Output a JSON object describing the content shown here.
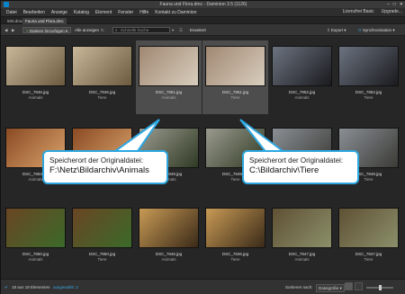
{
  "window": {
    "title": "Fauna und Flora.dmc - Daminion 3.5 (1126)",
    "controls": [
      "–",
      "□",
      "✕"
    ]
  },
  "menubar": {
    "items": [
      "Datei",
      "Bearbeiten",
      "Anzeige",
      "Katalog",
      "Element",
      "Fenster",
      "Hilfe",
      "Kontakt zu Daminion"
    ],
    "right": [
      "Lizenzfrei Basic",
      "Upgrade..."
    ]
  },
  "tabs": [
    {
      "label": "500.dmc"
    },
    {
      "label": "Fauna und Flora.dmc"
    }
  ],
  "toolbar": {
    "add_files_label": "Dateien hinzufügen",
    "show_all_label": "Alle anzeigen",
    "search_placeholder": "Schnelle Suche",
    "advanced_label": "Erweitert",
    "export_label": "Export",
    "sync_label": "Synchronisation"
  },
  "grid": {
    "rows": [
      [
        {
          "file": "DSC_7846.jpg",
          "tag": "Animals",
          "selected": false,
          "c1": "#c9b79a",
          "c2": "#6b5a3e"
        },
        {
          "file": "DSC_7846.jpg",
          "tag": "Tiere",
          "selected": false,
          "c1": "#c9b79a",
          "c2": "#6b5a3e"
        },
        {
          "file": "DSC_7851.jpg",
          "tag": "Animals",
          "selected": true,
          "c1": "#a08872",
          "c2": "#d8cdbd"
        },
        {
          "file": "DSC_7851.jpg",
          "tag": "Tiere",
          "selected": true,
          "c1": "#a08872",
          "c2": "#d8cdbd"
        },
        {
          "file": "DSC_7852.jpg",
          "tag": "Animals",
          "selected": false,
          "c1": "#6c7380",
          "c2": "#1a1a1e"
        },
        {
          "file": "DSC_7852.jpg",
          "tag": "Tiere",
          "selected": false,
          "c1": "#6c7380",
          "c2": "#1a1a1e"
        }
      ],
      [
        {
          "file": "DSC_7853.jpg",
          "tag": "Animals",
          "selected": false,
          "c1": "#8a4a24",
          "c2": "#d9a36b"
        },
        {
          "file": "DSC_7853.jpg",
          "tag": "Tiere",
          "selected": false,
          "c1": "#8a4a24",
          "c2": "#d9a36b"
        },
        {
          "file": "DSC_7849.jpg",
          "tag": "Animals",
          "selected": false,
          "c1": "#9a9a8e",
          "c2": "#2f3a24"
        },
        {
          "file": "DSC_7849.jpg",
          "tag": "Tiere",
          "selected": false,
          "c1": "#9a9a8e",
          "c2": "#2f3a24"
        },
        {
          "file": "DSC_7848.jpg",
          "tag": "Animals",
          "selected": false,
          "c1": "#8a8f95",
          "c2": "#3b3b36"
        },
        {
          "file": "DSC_7848.jpg",
          "tag": "Tiere",
          "selected": false,
          "c1": "#8a8f95",
          "c2": "#3b3b36"
        }
      ],
      [
        {
          "file": "DSC_7850.jpg",
          "tag": "Animals",
          "selected": false,
          "c1": "#6a4524",
          "c2": "#3b6a2a"
        },
        {
          "file": "DSC_7850.jpg",
          "tag": "Tiere",
          "selected": false,
          "c1": "#6a4524",
          "c2": "#3b6a2a"
        },
        {
          "file": "DSC_7846.jpg",
          "tag": "Animals",
          "selected": false,
          "c1": "#c89a55",
          "c2": "#3a2a18"
        },
        {
          "file": "DSC_7846.jpg",
          "tag": "Tiere",
          "selected": false,
          "c1": "#c89a55",
          "c2": "#3a2a18"
        },
        {
          "file": "DSC_7847.jpg",
          "tag": "Animals",
          "selected": false,
          "c1": "#5f5134",
          "c2": "#8b8f6a"
        },
        {
          "file": "DSC_7847.jpg",
          "tag": "Tiere",
          "selected": false,
          "c1": "#5f5134",
          "c2": "#8b8f6a"
        }
      ]
    ]
  },
  "callouts": {
    "left": {
      "title": "Speicherort der Originaldatei:",
      "path": "F:\\Netz\\Bildarchiv\\Animals"
    },
    "right": {
      "title": "Speicherort der Originaldatei:",
      "path": "C:\\Bildarchiv\\Tiere"
    }
  },
  "statusbar": {
    "count_text": "18 aus 18 Elementen",
    "selected_text": "ausgewählt: 2",
    "sort_label": "Sortieren nach:",
    "sort_value": "Dateigröße"
  },
  "colors": {
    "accent": "#2ea7e0",
    "link": "#39a3dd"
  }
}
